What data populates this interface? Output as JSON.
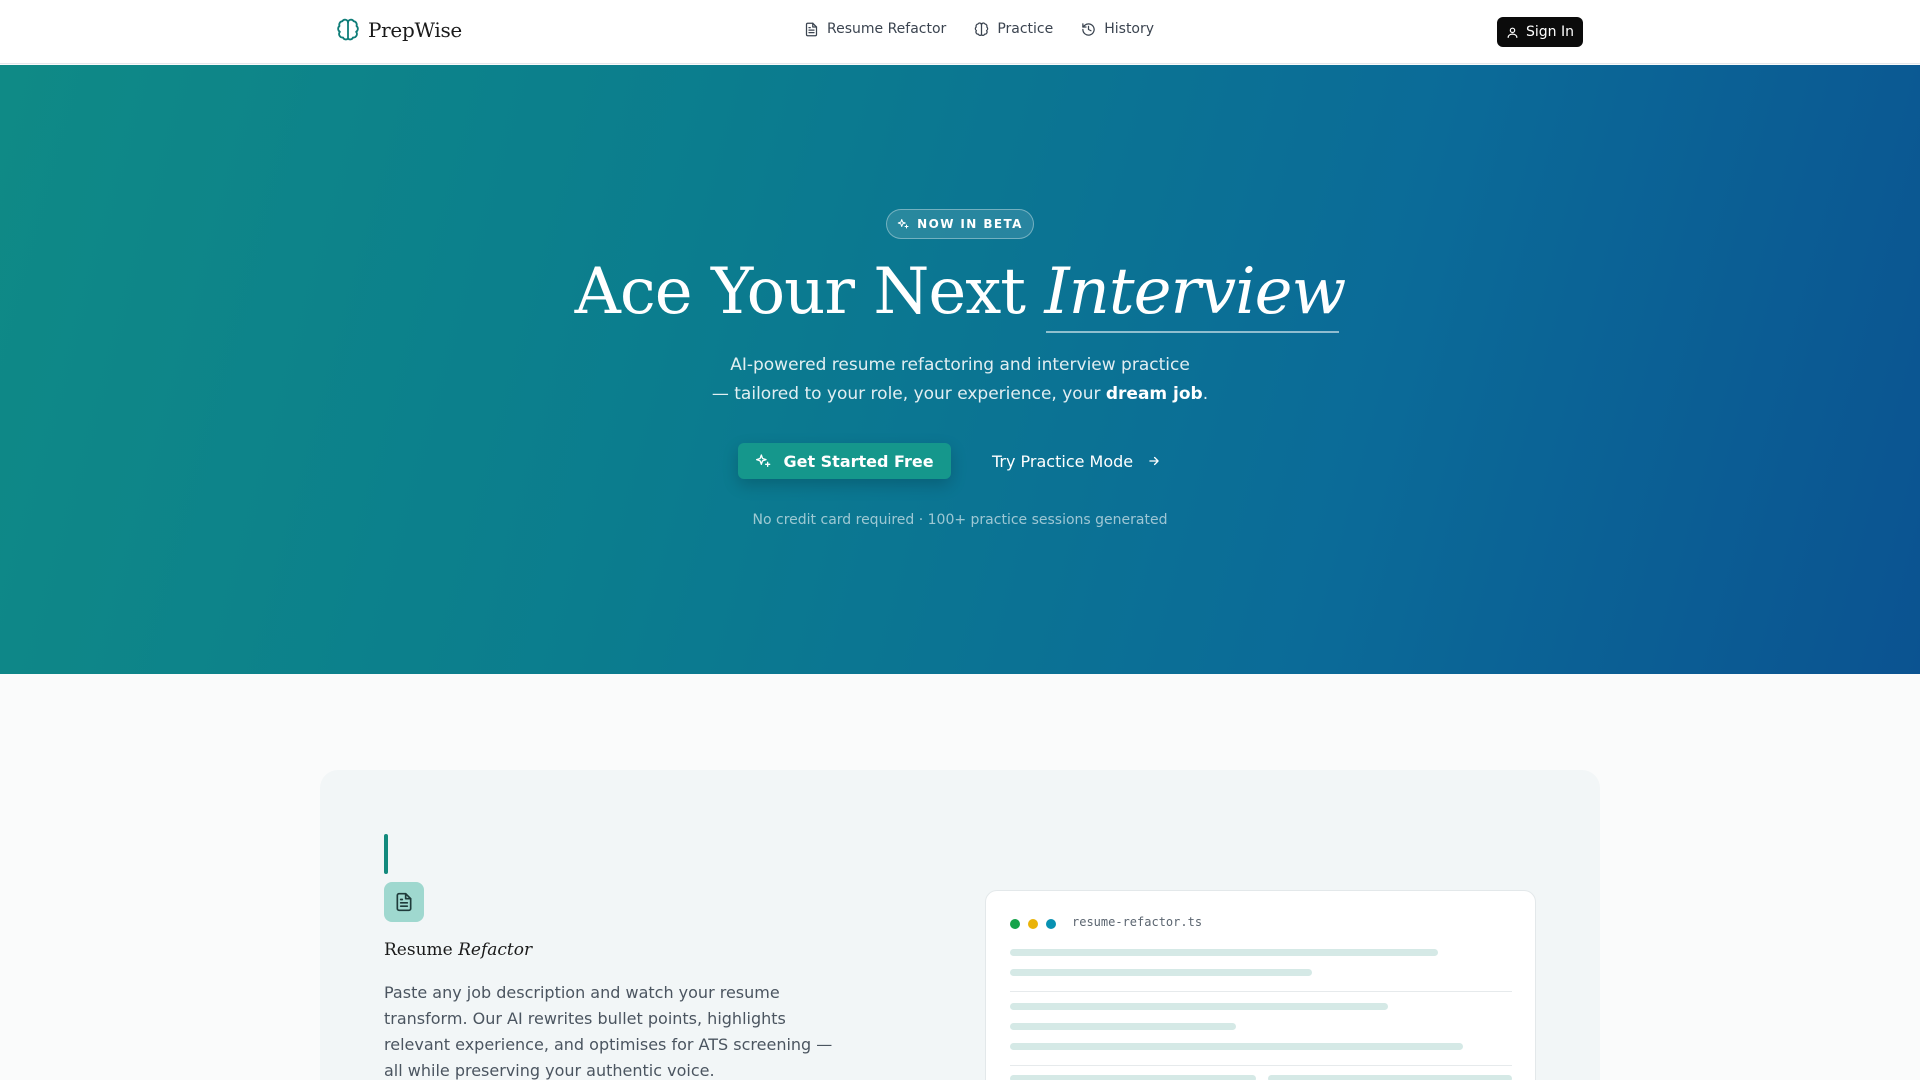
{
  "header": {
    "brand": "PrepWise",
    "nav": [
      {
        "label": "Resume Refactor",
        "icon": "document-icon"
      },
      {
        "label": "Practice",
        "icon": "brain-icon"
      },
      {
        "label": "History",
        "icon": "history-icon"
      }
    ],
    "sign_in": "Sign In"
  },
  "hero": {
    "badge": "NOW IN BETA",
    "title_plain": "Ace Your Next",
    "title_italic": "Interview",
    "subtitle_line1": "AI-powered resume refactoring and interview practice",
    "subtitle_line2": "— tailored to your role, your experience, your",
    "subtitle_bold": "dream job",
    "subtitle_end": ".",
    "primary_cta": "Get Started Free",
    "secondary_cta": "Try Practice Mode",
    "note": "No credit card required · 100+ practice sessions generated"
  },
  "feature": {
    "title_plain": "Resume",
    "title_italic": "Refactor",
    "description": "Paste any job description and watch your resume transform. Our AI rewrites bullet points, highlights relevant experience, and optimises for ATS screening — all while preserving your authentic voice.",
    "editor_filename": "resume-refactor.ts"
  },
  "colors": {
    "accent": "#138a7d",
    "hero_start": "#0f8a86",
    "hero_end": "#0b5391",
    "dot_green": "#16a34a",
    "dot_amber": "#eab308",
    "dot_blue": "#0891b2"
  }
}
